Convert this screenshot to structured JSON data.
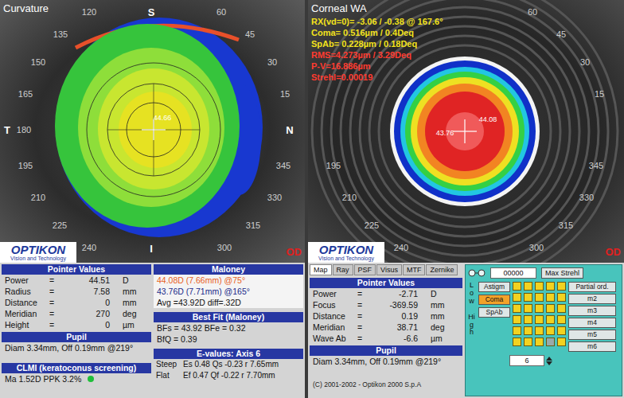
{
  "left_panel": {
    "title": "Curvature",
    "eye": "OD",
    "map_values": [
      "44.66"
    ],
    "angle_labels": [
      {
        "text": "120",
        "kind": "degree"
      },
      {
        "text": "S",
        "kind": "compass"
      },
      {
        "text": "60",
        "kind": "degree"
      },
      {
        "text": "135",
        "kind": "degree"
      },
      {
        "text": "45",
        "kind": "degree"
      },
      {
        "text": "150",
        "kind": "degree"
      },
      {
        "text": "30",
        "kind": "degree"
      },
      {
        "text": "165",
        "kind": "degree"
      },
      {
        "text": "15",
        "kind": "degree"
      },
      {
        "text": "T",
        "kind": "compass"
      },
      {
        "text": "180",
        "kind": "degree"
      },
      {
        "text": "N",
        "kind": "compass"
      },
      {
        "text": "195",
        "kind": "degree"
      },
      {
        "text": "345",
        "kind": "degree"
      },
      {
        "text": "210",
        "kind": "degree"
      },
      {
        "text": "330",
        "kind": "degree"
      },
      {
        "text": "225",
        "kind": "degree"
      },
      {
        "text": "315",
        "kind": "degree"
      },
      {
        "text": "240",
        "kind": "degree"
      },
      {
        "text": "I",
        "kind": "compass"
      },
      {
        "text": "300",
        "kind": "degree"
      }
    ],
    "logo": {
      "name": "OPTIKON",
      "tagline": "Vision and Technology"
    },
    "pointer_values": {
      "title": "Pointer Values",
      "rows": [
        {
          "label": "Power",
          "eq": "=",
          "value": "44.51",
          "unit": "D"
        },
        {
          "label": "Radius",
          "eq": "=",
          "value": "7.58",
          "unit": "mm"
        },
        {
          "label": "Distance",
          "eq": "=",
          "value": "0",
          "unit": "mm"
        },
        {
          "label": "Meridian",
          "eq": "=",
          "value": "270",
          "unit": "deg"
        },
        {
          "label": "Height",
          "eq": "=",
          "value": "0",
          "unit": "µm"
        }
      ]
    },
    "pupil": {
      "title": "Pupil",
      "text": "Diam 3.34mm, Off 0.19mm @219°"
    },
    "clmi": {
      "title": "CLMI (keratoconus screening)",
      "text": "Ma 1.52D PPK 3.2%",
      "color": "#1fbf3a"
    },
    "maloney": {
      "title": "Maloney",
      "lines": [
        {
          "text": "44.08D (7.66mm) @75°",
          "color": "#e8601c"
        },
        {
          "text": "43.76D (7.71mm) @165°",
          "color": "#1a2a8a"
        },
        {
          "text": "Avg =43.92D diff=.32D",
          "color": "#111111"
        }
      ]
    },
    "best_fit": {
      "title": "Best Fit (Maloney)",
      "lines": [
        "BFs = 43.92 BFe = 0.32",
        "BfQ = 0.39"
      ]
    },
    "e_values": {
      "title": "E-values: Axis 6",
      "rows": [
        {
          "label": "Steep",
          "text": "Es 0.48 Qs -0.23 r 7.65mm"
        },
        {
          "label": "Flat",
          "text": "Ef 0.47 Qf -0.22 r 7.70mm"
        }
      ]
    }
  },
  "right_panel": {
    "title": "Corneal WA",
    "eye": "OD",
    "wavefront_lines": [
      {
        "text": "RX(vd=0)= -3.06 / -0.38 @ 167.6°",
        "color": "#f2e21c"
      },
      {
        "text": "Coma= 0.516µm / 0.4Deq",
        "color": "#f2e21c"
      },
      {
        "text": "SpAb= 0.228µm / 0.18Deq",
        "color": "#f2e21c"
      },
      {
        "text": "RMS=4.273µm / 3.29Deq",
        "color": "#ff3b30"
      },
      {
        "text": "P-V=16.886µm",
        "color": "#ff3b30"
      },
      {
        "text": "Strehl=0.00019",
        "color": "#ff3b30"
      }
    ],
    "map_values": [
      "44.08",
      "43.76"
    ],
    "angle_labels": [
      {
        "text": "60"
      },
      {
        "text": "45"
      },
      {
        "text": "30"
      },
      {
        "text": "15"
      },
      {
        "text": "345"
      },
      {
        "text": "330"
      },
      {
        "text": "315"
      },
      {
        "text": "300"
      },
      {
        "text": "240"
      },
      {
        "text": "225"
      },
      {
        "text": "210"
      },
      {
        "text": "195"
      }
    ],
    "logo": {
      "name": "OPTIKON",
      "tagline": "Vision and Technology"
    },
    "tabs": [
      {
        "label": "Map",
        "selected": true
      },
      {
        "label": "Ray",
        "selected": false
      },
      {
        "label": "PSF",
        "selected": false
      },
      {
        "label": "Visus",
        "selected": false
      },
      {
        "label": "MTF",
        "selected": false
      },
      {
        "label": "Zernike",
        "selected": false
      }
    ],
    "pointer_values": {
      "title": "Pointer Values",
      "rows": [
        {
          "label": "Power",
          "eq": "=",
          "value": "-2.71",
          "unit": "D"
        },
        {
          "label": "Focus",
          "eq": "=",
          "value": "-369.59",
          "unit": "mm"
        },
        {
          "label": "Distance",
          "eq": "=",
          "value": "0.19",
          "unit": "mm"
        },
        {
          "label": "Meridian",
          "eq": "=",
          "value": "38.71",
          "unit": "deg"
        },
        {
          "label": "Wave Ab",
          "eq": "=",
          "value": "-6.6",
          "unit": "µm"
        }
      ]
    },
    "pupil": {
      "title": "Pupil",
      "text": "Diam 3.34mm, Off 0.19mm @219°"
    },
    "copyright": "(C) 2001-2002 - Optikon 2000 S.p.A",
    "controls": {
      "field": "00000",
      "max_button": "Max Strehl",
      "side_labels": [
        "Low",
        "High"
      ],
      "left_buttons": [
        {
          "label": "Astigm",
          "selected": false
        },
        {
          "label": "Coma",
          "selected": true
        },
        {
          "label": "SpAb",
          "selected": false
        }
      ],
      "right_items": [
        "Partial ord.",
        "m2",
        "m3",
        "m4",
        "m5",
        "m6"
      ],
      "zernike_terms": [
        [
          {
            "on": true
          },
          {
            "on": true
          },
          {
            "on": true
          },
          {
            "on": true
          },
          {
            "on": true
          }
        ],
        [
          {
            "on": true
          },
          {
            "on": true
          },
          {
            "on": true
          },
          {
            "on": true
          },
          {
            "on": true
          }
        ],
        [
          {
            "on": true
          },
          {
            "on": true
          },
          {
            "on": true
          },
          {
            "on": true
          },
          {
            "on": true
          }
        ],
        [
          {
            "on": true
          },
          {
            "on": true
          },
          {
            "on": true
          },
          {
            "on": true
          },
          {
            "on": true
          }
        ],
        [
          {
            "on": true
          },
          {
            "on": true
          },
          {
            "on": true
          },
          {
            "on": true
          },
          {
            "on": true
          }
        ],
        [
          {
            "on": true
          },
          {
            "on": true
          },
          {
            "on": true
          },
          {
            "on": false
          },
          {
            "on": true
          }
        ]
      ],
      "order_value": "6"
    }
  }
}
